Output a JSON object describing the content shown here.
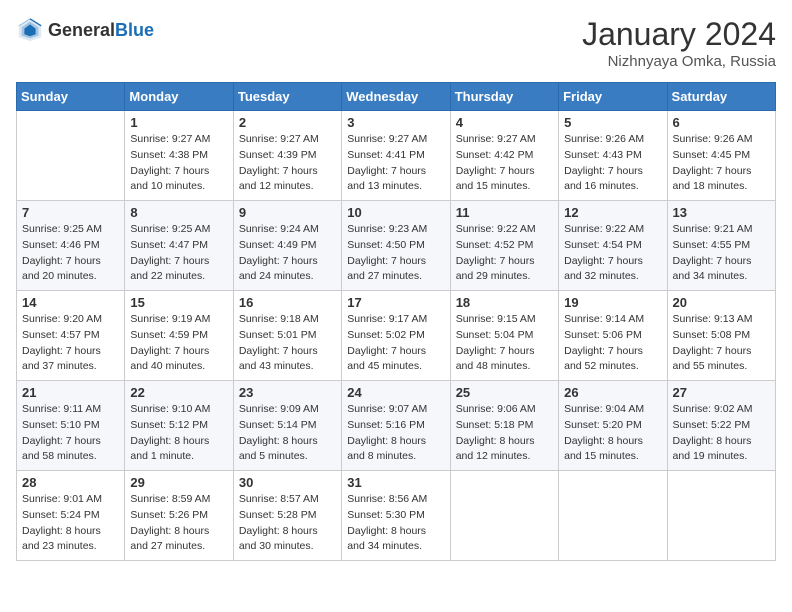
{
  "header": {
    "logo_general": "General",
    "logo_blue": "Blue",
    "month": "January 2024",
    "location": "Nizhnyaya Omka, Russia"
  },
  "weekdays": [
    "Sunday",
    "Monday",
    "Tuesday",
    "Wednesday",
    "Thursday",
    "Friday",
    "Saturday"
  ],
  "weeks": [
    [
      {
        "day": "",
        "sunrise": "",
        "sunset": "",
        "daylight": ""
      },
      {
        "day": "1",
        "sunrise": "Sunrise: 9:27 AM",
        "sunset": "Sunset: 4:38 PM",
        "daylight": "Daylight: 7 hours and 10 minutes."
      },
      {
        "day": "2",
        "sunrise": "Sunrise: 9:27 AM",
        "sunset": "Sunset: 4:39 PM",
        "daylight": "Daylight: 7 hours and 12 minutes."
      },
      {
        "day": "3",
        "sunrise": "Sunrise: 9:27 AM",
        "sunset": "Sunset: 4:41 PM",
        "daylight": "Daylight: 7 hours and 13 minutes."
      },
      {
        "day": "4",
        "sunrise": "Sunrise: 9:27 AM",
        "sunset": "Sunset: 4:42 PM",
        "daylight": "Daylight: 7 hours and 15 minutes."
      },
      {
        "day": "5",
        "sunrise": "Sunrise: 9:26 AM",
        "sunset": "Sunset: 4:43 PM",
        "daylight": "Daylight: 7 hours and 16 minutes."
      },
      {
        "day": "6",
        "sunrise": "Sunrise: 9:26 AM",
        "sunset": "Sunset: 4:45 PM",
        "daylight": "Daylight: 7 hours and 18 minutes."
      }
    ],
    [
      {
        "day": "7",
        "sunrise": "Sunrise: 9:25 AM",
        "sunset": "Sunset: 4:46 PM",
        "daylight": "Daylight: 7 hours and 20 minutes."
      },
      {
        "day": "8",
        "sunrise": "Sunrise: 9:25 AM",
        "sunset": "Sunset: 4:47 PM",
        "daylight": "Daylight: 7 hours and 22 minutes."
      },
      {
        "day": "9",
        "sunrise": "Sunrise: 9:24 AM",
        "sunset": "Sunset: 4:49 PM",
        "daylight": "Daylight: 7 hours and 24 minutes."
      },
      {
        "day": "10",
        "sunrise": "Sunrise: 9:23 AM",
        "sunset": "Sunset: 4:50 PM",
        "daylight": "Daylight: 7 hours and 27 minutes."
      },
      {
        "day": "11",
        "sunrise": "Sunrise: 9:22 AM",
        "sunset": "Sunset: 4:52 PM",
        "daylight": "Daylight: 7 hours and 29 minutes."
      },
      {
        "day": "12",
        "sunrise": "Sunrise: 9:22 AM",
        "sunset": "Sunset: 4:54 PM",
        "daylight": "Daylight: 7 hours and 32 minutes."
      },
      {
        "day": "13",
        "sunrise": "Sunrise: 9:21 AM",
        "sunset": "Sunset: 4:55 PM",
        "daylight": "Daylight: 7 hours and 34 minutes."
      }
    ],
    [
      {
        "day": "14",
        "sunrise": "Sunrise: 9:20 AM",
        "sunset": "Sunset: 4:57 PM",
        "daylight": "Daylight: 7 hours and 37 minutes."
      },
      {
        "day": "15",
        "sunrise": "Sunrise: 9:19 AM",
        "sunset": "Sunset: 4:59 PM",
        "daylight": "Daylight: 7 hours and 40 minutes."
      },
      {
        "day": "16",
        "sunrise": "Sunrise: 9:18 AM",
        "sunset": "Sunset: 5:01 PM",
        "daylight": "Daylight: 7 hours and 43 minutes."
      },
      {
        "day": "17",
        "sunrise": "Sunrise: 9:17 AM",
        "sunset": "Sunset: 5:02 PM",
        "daylight": "Daylight: 7 hours and 45 minutes."
      },
      {
        "day": "18",
        "sunrise": "Sunrise: 9:15 AM",
        "sunset": "Sunset: 5:04 PM",
        "daylight": "Daylight: 7 hours and 48 minutes."
      },
      {
        "day": "19",
        "sunrise": "Sunrise: 9:14 AM",
        "sunset": "Sunset: 5:06 PM",
        "daylight": "Daylight: 7 hours and 52 minutes."
      },
      {
        "day": "20",
        "sunrise": "Sunrise: 9:13 AM",
        "sunset": "Sunset: 5:08 PM",
        "daylight": "Daylight: 7 hours and 55 minutes."
      }
    ],
    [
      {
        "day": "21",
        "sunrise": "Sunrise: 9:11 AM",
        "sunset": "Sunset: 5:10 PM",
        "daylight": "Daylight: 7 hours and 58 minutes."
      },
      {
        "day": "22",
        "sunrise": "Sunrise: 9:10 AM",
        "sunset": "Sunset: 5:12 PM",
        "daylight": "Daylight: 8 hours and 1 minute."
      },
      {
        "day": "23",
        "sunrise": "Sunrise: 9:09 AM",
        "sunset": "Sunset: 5:14 PM",
        "daylight": "Daylight: 8 hours and 5 minutes."
      },
      {
        "day": "24",
        "sunrise": "Sunrise: 9:07 AM",
        "sunset": "Sunset: 5:16 PM",
        "daylight": "Daylight: 8 hours and 8 minutes."
      },
      {
        "day": "25",
        "sunrise": "Sunrise: 9:06 AM",
        "sunset": "Sunset: 5:18 PM",
        "daylight": "Daylight: 8 hours and 12 minutes."
      },
      {
        "day": "26",
        "sunrise": "Sunrise: 9:04 AM",
        "sunset": "Sunset: 5:20 PM",
        "daylight": "Daylight: 8 hours and 15 minutes."
      },
      {
        "day": "27",
        "sunrise": "Sunrise: 9:02 AM",
        "sunset": "Sunset: 5:22 PM",
        "daylight": "Daylight: 8 hours and 19 minutes."
      }
    ],
    [
      {
        "day": "28",
        "sunrise": "Sunrise: 9:01 AM",
        "sunset": "Sunset: 5:24 PM",
        "daylight": "Daylight: 8 hours and 23 minutes."
      },
      {
        "day": "29",
        "sunrise": "Sunrise: 8:59 AM",
        "sunset": "Sunset: 5:26 PM",
        "daylight": "Daylight: 8 hours and 27 minutes."
      },
      {
        "day": "30",
        "sunrise": "Sunrise: 8:57 AM",
        "sunset": "Sunset: 5:28 PM",
        "daylight": "Daylight: 8 hours and 30 minutes."
      },
      {
        "day": "31",
        "sunrise": "Sunrise: 8:56 AM",
        "sunset": "Sunset: 5:30 PM",
        "daylight": "Daylight: 8 hours and 34 minutes."
      },
      {
        "day": "",
        "sunrise": "",
        "sunset": "",
        "daylight": ""
      },
      {
        "day": "",
        "sunrise": "",
        "sunset": "",
        "daylight": ""
      },
      {
        "day": "",
        "sunrise": "",
        "sunset": "",
        "daylight": ""
      }
    ]
  ]
}
